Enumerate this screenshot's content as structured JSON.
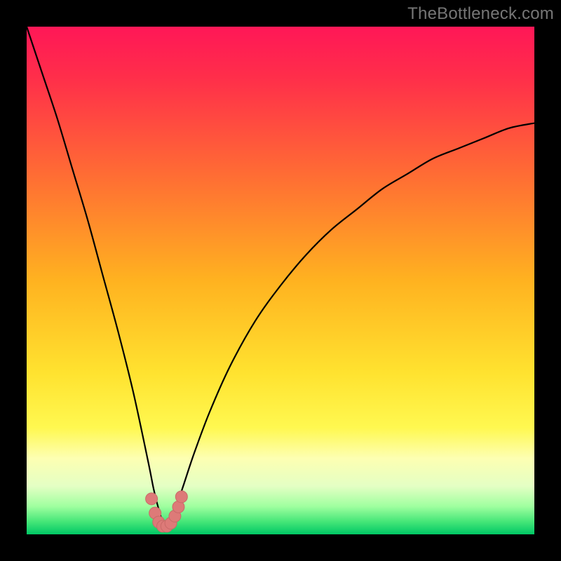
{
  "watermark": "TheBottleneck.com",
  "colors": {
    "frame": "#000000",
    "gradient_stops": [
      {
        "offset": 0.0,
        "color": "#ff1757"
      },
      {
        "offset": 0.1,
        "color": "#ff2e4a"
      },
      {
        "offset": 0.3,
        "color": "#ff6f33"
      },
      {
        "offset": 0.5,
        "color": "#ffb220"
      },
      {
        "offset": 0.68,
        "color": "#ffe22f"
      },
      {
        "offset": 0.79,
        "color": "#fff850"
      },
      {
        "offset": 0.85,
        "color": "#fdffb2"
      },
      {
        "offset": 0.905,
        "color": "#e4ffc4"
      },
      {
        "offset": 0.945,
        "color": "#9fff9f"
      },
      {
        "offset": 0.975,
        "color": "#45e678"
      },
      {
        "offset": 1.0,
        "color": "#00c765"
      }
    ],
    "curve": "#000000",
    "marker_fill": "#dd7a78",
    "marker_stroke": "#c96a68"
  },
  "chart_data": {
    "type": "line",
    "title": "",
    "xlabel": "",
    "ylabel": "",
    "x_range": [
      0,
      100
    ],
    "y_range": [
      0,
      100
    ],
    "note": "V-shaped bottleneck curve. y is the mismatch/bottleneck percentage; minimum (~0) occurs around x≈27. Values are visually estimated from the plot (no axis ticks shown).",
    "series": [
      {
        "name": "bottleneck-curve",
        "x": [
          0,
          3,
          6,
          9,
          12,
          15,
          18,
          21,
          24,
          25,
          26,
          27,
          28,
          29,
          30,
          31,
          33,
          36,
          40,
          45,
          50,
          55,
          60,
          65,
          70,
          75,
          80,
          85,
          90,
          95,
          100
        ],
        "y": [
          100,
          91,
          82,
          72,
          62,
          51,
          40,
          28,
          14,
          9,
          5,
          2,
          2,
          4,
          7,
          10,
          16,
          24,
          33,
          42,
          49,
          55,
          60,
          64,
          68,
          71,
          74,
          76,
          78,
          80,
          81
        ]
      }
    ],
    "markers": {
      "name": "min-region",
      "x": [
        24.6,
        25.3,
        26.0,
        26.8,
        27.6,
        28.4,
        29.2,
        29.9,
        30.5
      ],
      "y": [
        7.0,
        4.2,
        2.4,
        1.6,
        1.6,
        2.2,
        3.6,
        5.4,
        7.4
      ]
    }
  }
}
